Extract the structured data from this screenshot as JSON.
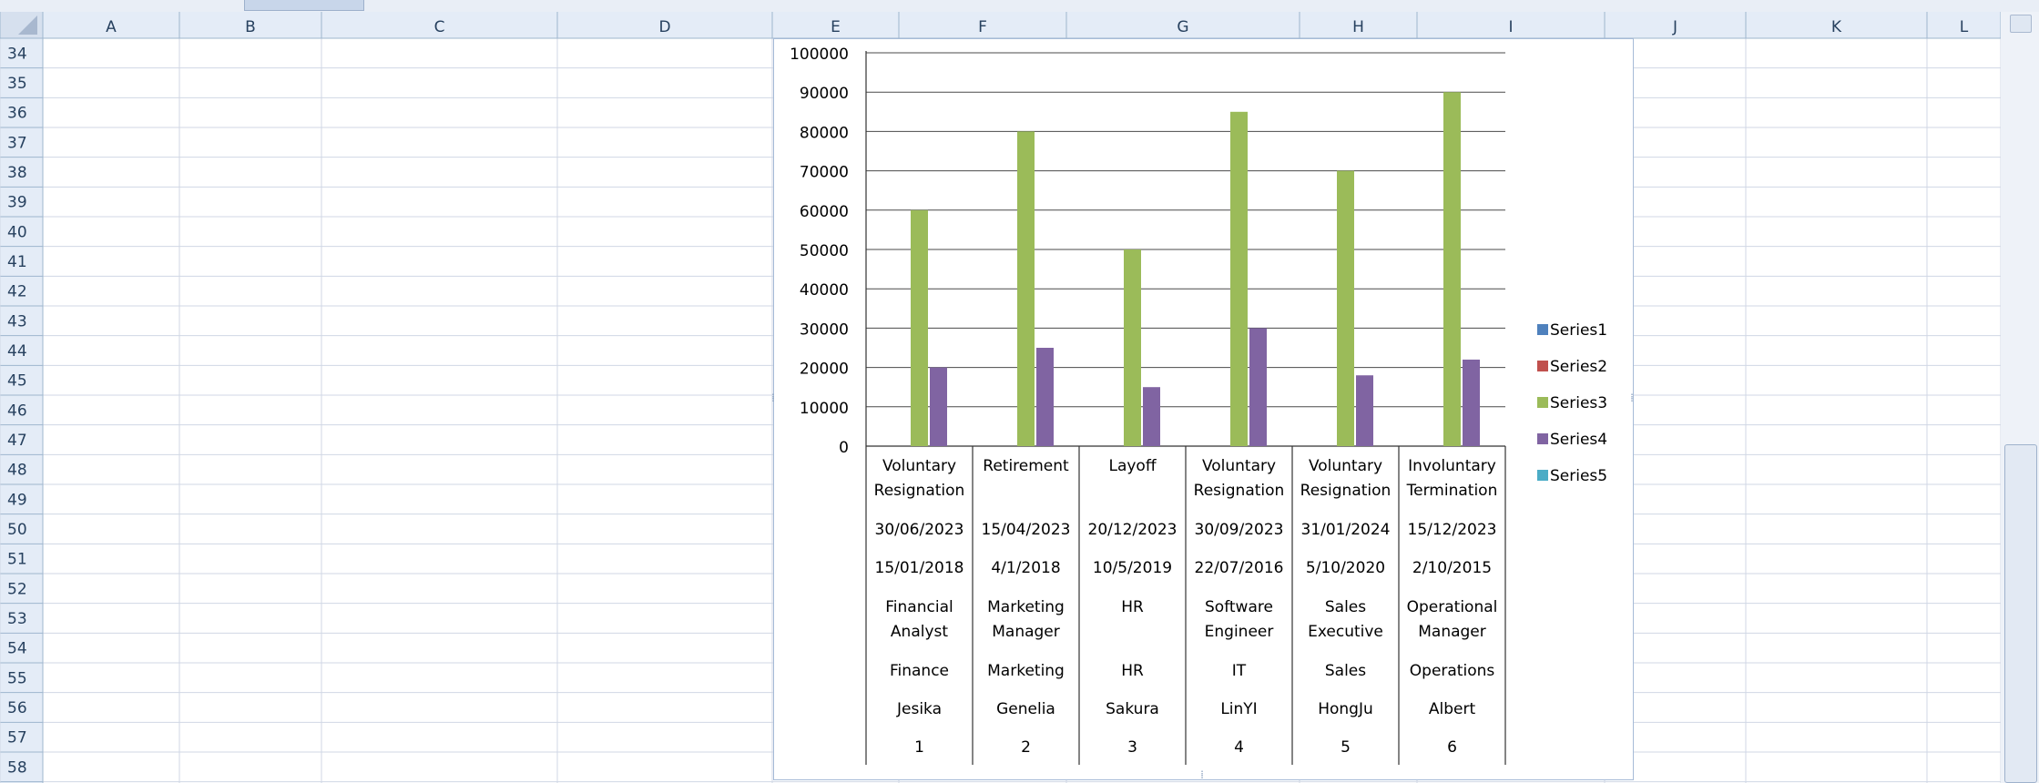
{
  "sheet": {
    "columns": [
      "A",
      "B",
      "C",
      "D",
      "E",
      "F",
      "G",
      "H",
      "I",
      "J",
      "K",
      "L"
    ],
    "rows": [
      "34",
      "35",
      "36",
      "37",
      "38",
      "39",
      "40",
      "41",
      "42",
      "43",
      "44",
      "45",
      "46",
      "47",
      "48",
      "49",
      "50",
      "51",
      "52",
      "53",
      "54",
      "55",
      "56",
      "57",
      "58"
    ]
  },
  "chart_data": {
    "type": "bar",
    "ylim": [
      0,
      100000
    ],
    "yticks": [
      "100000",
      "90000",
      "80000",
      "70000",
      "60000",
      "50000",
      "40000",
      "30000",
      "20000",
      "10000",
      "0"
    ],
    "category_rows": [
      [
        [
          "Voluntary",
          "Resignation"
        ],
        [
          "Retirement"
        ],
        [
          "Layoff"
        ],
        [
          "Voluntary",
          "Resignation"
        ],
        [
          "Voluntary",
          "Resignation"
        ],
        [
          "Involuntary",
          "Termination"
        ]
      ],
      [
        [
          "30/06/2023"
        ],
        [
          "15/04/2023"
        ],
        [
          "20/12/2023"
        ],
        [
          "30/09/2023"
        ],
        [
          "31/01/2024"
        ],
        [
          "15/12/2023"
        ]
      ],
      [
        [
          "15/01/2018"
        ],
        [
          "4/1/2018"
        ],
        [
          "10/5/2019"
        ],
        [
          "22/07/2016"
        ],
        [
          "5/10/2020"
        ],
        [
          "2/10/2015"
        ]
      ],
      [
        [
          "Financial",
          "Analyst"
        ],
        [
          "Marketing",
          "Manager"
        ],
        [
          "HR"
        ],
        [
          "Software",
          "Engineer"
        ],
        [
          "Sales",
          "Executive"
        ],
        [
          "Operational",
          "Manager"
        ]
      ],
      [
        [
          "Finance"
        ],
        [
          "Marketing"
        ],
        [
          "HR"
        ],
        [
          "IT"
        ],
        [
          "Sales"
        ],
        [
          "Operations"
        ]
      ],
      [
        [
          "Jesika"
        ],
        [
          "Genelia"
        ],
        [
          "Sakura"
        ],
        [
          "LinYI"
        ],
        [
          "HongJu"
        ],
        [
          "Albert"
        ]
      ],
      [
        [
          "1"
        ],
        [
          "2"
        ],
        [
          "3"
        ],
        [
          "4"
        ],
        [
          "5"
        ],
        [
          "6"
        ]
      ]
    ],
    "series": [
      {
        "name": "Series1",
        "color": "#4f81bd",
        "values": [
          0,
          0,
          0,
          0,
          0,
          0
        ]
      },
      {
        "name": "Series2",
        "color": "#c0504d",
        "values": [
          0,
          0,
          0,
          0,
          0,
          0
        ]
      },
      {
        "name": "Series3",
        "color": "#9bbb59",
        "values": [
          60000,
          80000,
          50000,
          85000,
          70000,
          90000
        ]
      },
      {
        "name": "Series4",
        "color": "#8064a2",
        "values": [
          20000,
          25000,
          15000,
          30000,
          18000,
          22000
        ]
      },
      {
        "name": "Series5",
        "color": "#4bacc6",
        "values": [
          0,
          0,
          0,
          0,
          0,
          0
        ]
      }
    ],
    "legend_position": "right",
    "grid": true
  }
}
